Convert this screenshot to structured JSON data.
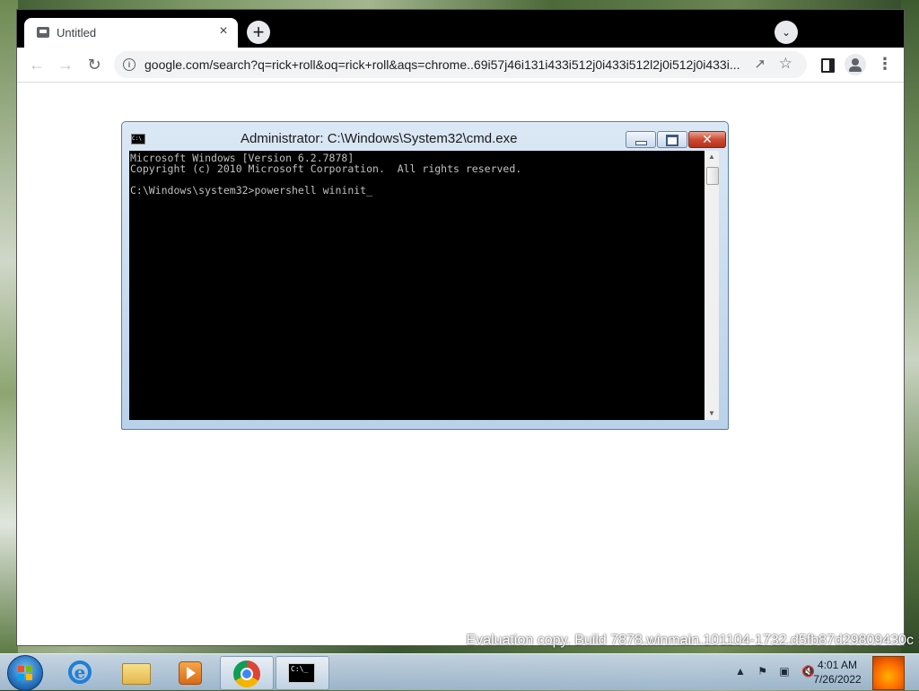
{
  "browser": {
    "tab_title": "Untitled",
    "tab_close": "×",
    "new_tab": "+",
    "tab_search": "⌄",
    "url": "google.com/search?q=rick+roll&oq=rick+roll&aqs=chrome..69i57j46i131i433i512j0i433i512l2j0i512j0i433i..."
  },
  "cmd": {
    "title": "Administrator: C:\\Windows\\System32\\cmd.exe",
    "close_label": "✕",
    "output": "Microsoft Windows [Version 6.2.7878]\nCopyright (c) 2010 Microsoft Corporation.  All rights reserved.\n\nC:\\Windows\\system32>powershell wininit",
    "cursor": "_"
  },
  "desktop": {
    "watermark": "Evaluation copy. Build 7878.winmain.101104-1732.d5fb87d29809430c"
  },
  "taskbar": {
    "apps": [
      "Internet Explorer",
      "Windows Explorer",
      "Windows Media Player",
      "Google Chrome",
      "Command Prompt"
    ],
    "clock_time": "4:01 AM",
    "clock_date": "7/26/2022",
    "tray_arrow": "▲"
  }
}
